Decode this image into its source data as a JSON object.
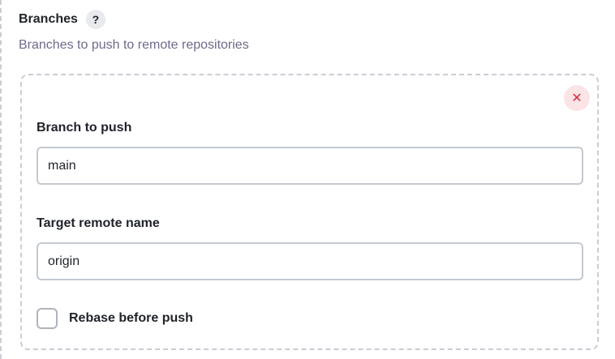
{
  "section": {
    "title": "Branches",
    "help_icon": "?",
    "description": "Branches to push to remote repositories"
  },
  "card": {
    "delete_icon": "✕",
    "branch_field": {
      "label": "Branch to push",
      "value": "main"
    },
    "remote_field": {
      "label": "Target remote name",
      "value": "origin"
    },
    "rebase_checkbox": {
      "label": "Rebase before push",
      "checked": false
    }
  },
  "colors": {
    "accent_danger": "#d92b3a",
    "danger_bg": "#fbe4e6",
    "description_text": "#6d6b8a",
    "border_dashed": "#c9ced6"
  }
}
